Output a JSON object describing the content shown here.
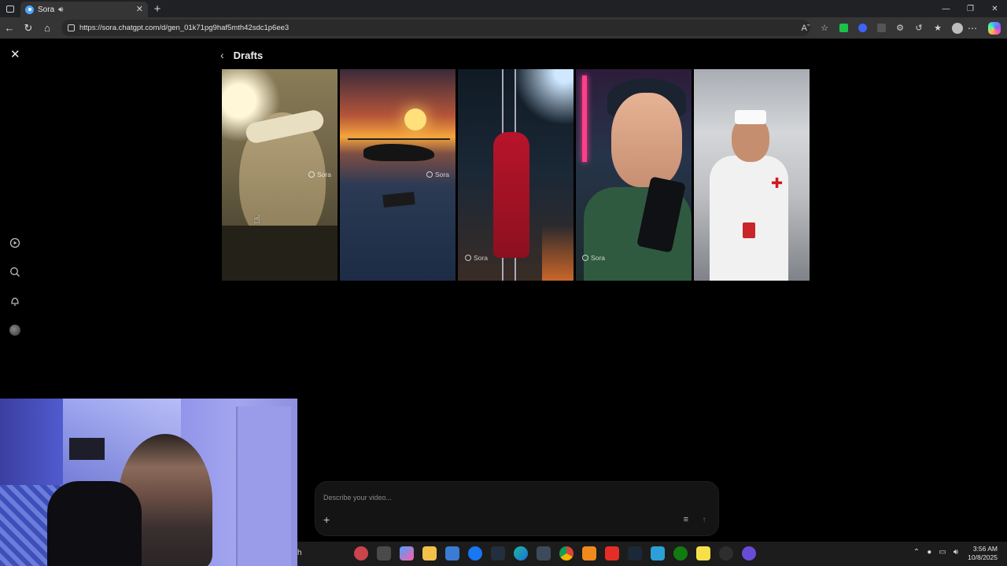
{
  "browser": {
    "tab_title": "Sora",
    "url": "https://sora.chatgpt.com/d/gen_01k71pg9haf5mth42sdc1p6ee3"
  },
  "page": {
    "title": "Drafts",
    "watermark": "Sora",
    "prompt_placeholder": "Describe your video..."
  },
  "drafts": [
    {
      "subject": "man with headband close-up",
      "watermark_visible": true
    },
    {
      "subject": "helicopter carrying box over ocean at sunset",
      "watermark_visible": true
    },
    {
      "subject": "man in red climbing ladder",
      "watermark_visible": true
    },
    {
      "subject": "anime man with phone in neon street",
      "watermark_visible": true
    },
    {
      "subject": "man in nurse outfit at convention",
      "watermark_visible": false
    }
  ],
  "sidebar": {
    "icons": [
      "video-icon",
      "search-icon",
      "bell-icon",
      "avatar"
    ]
  },
  "taskbar": {
    "search_text": "h",
    "time": "3:56 AM",
    "date": "10/8/2025"
  }
}
